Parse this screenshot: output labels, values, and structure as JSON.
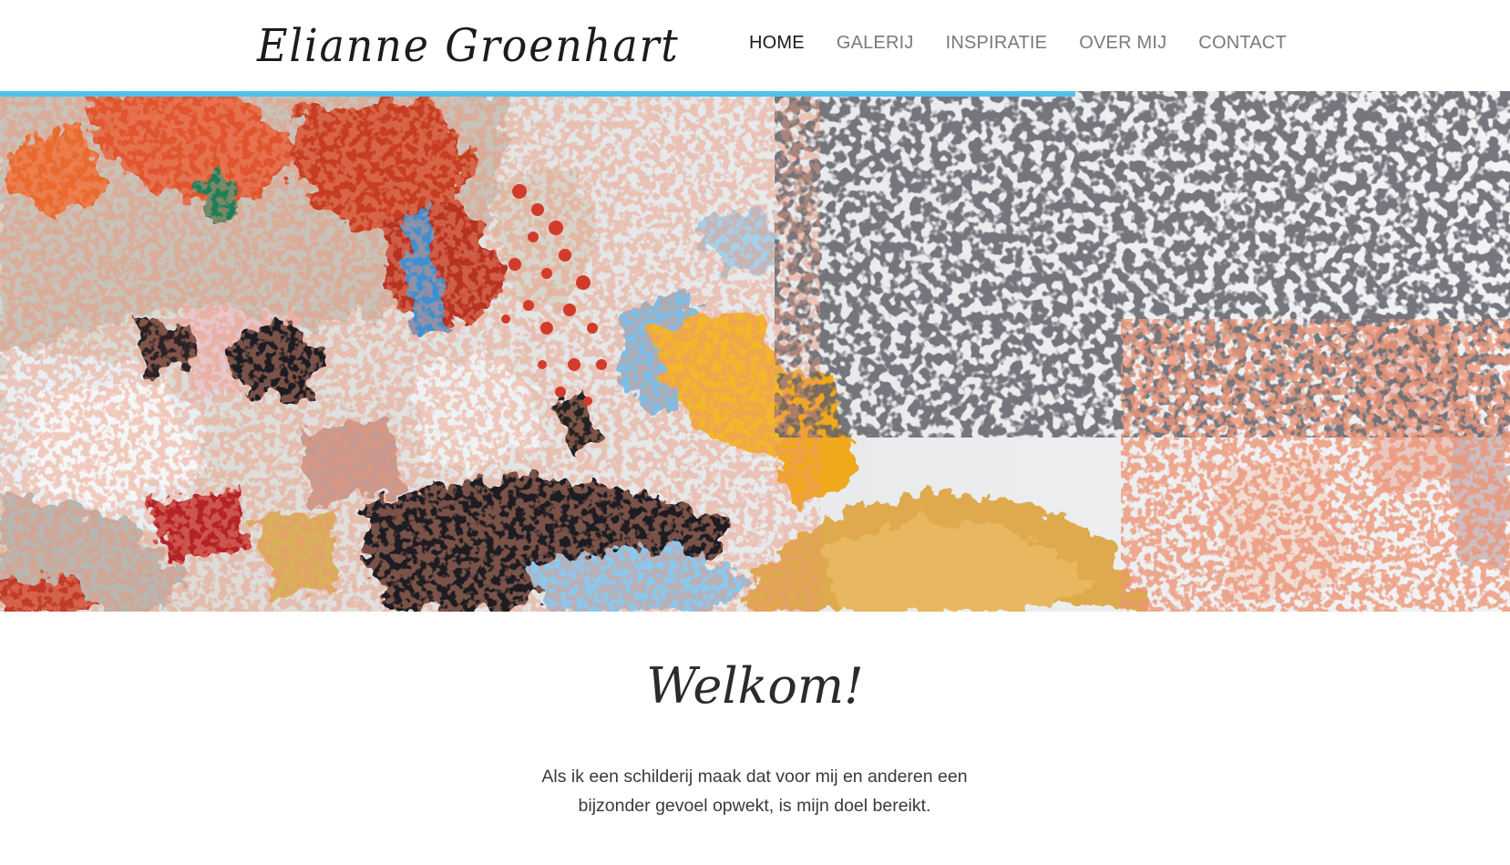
{
  "site": {
    "logo_text": "Elianne Groenhart"
  },
  "nav": {
    "items": [
      {
        "label": "HOME",
        "active": true
      },
      {
        "label": "GALERIJ",
        "active": false
      },
      {
        "label": "INSPIRATIE",
        "active": false
      },
      {
        "label": "OVER MIJ",
        "active": false
      },
      {
        "label": "CONTACT",
        "active": false
      }
    ]
  },
  "progress": {
    "fraction": 0.712,
    "color": "#4ec3ec"
  },
  "hero": {
    "image": "abstract-painting"
  },
  "main": {
    "heading": "Welkom!",
    "intro": "Als ik een schilderij maak dat voor mij en anderen een bijzonder gevoel opwekt, is mijn doel bereikt."
  },
  "colors": {
    "accent": "#4ec3ec",
    "nav_active": "#1a1a1a",
    "nav_inactive": "#7a7a7a"
  }
}
